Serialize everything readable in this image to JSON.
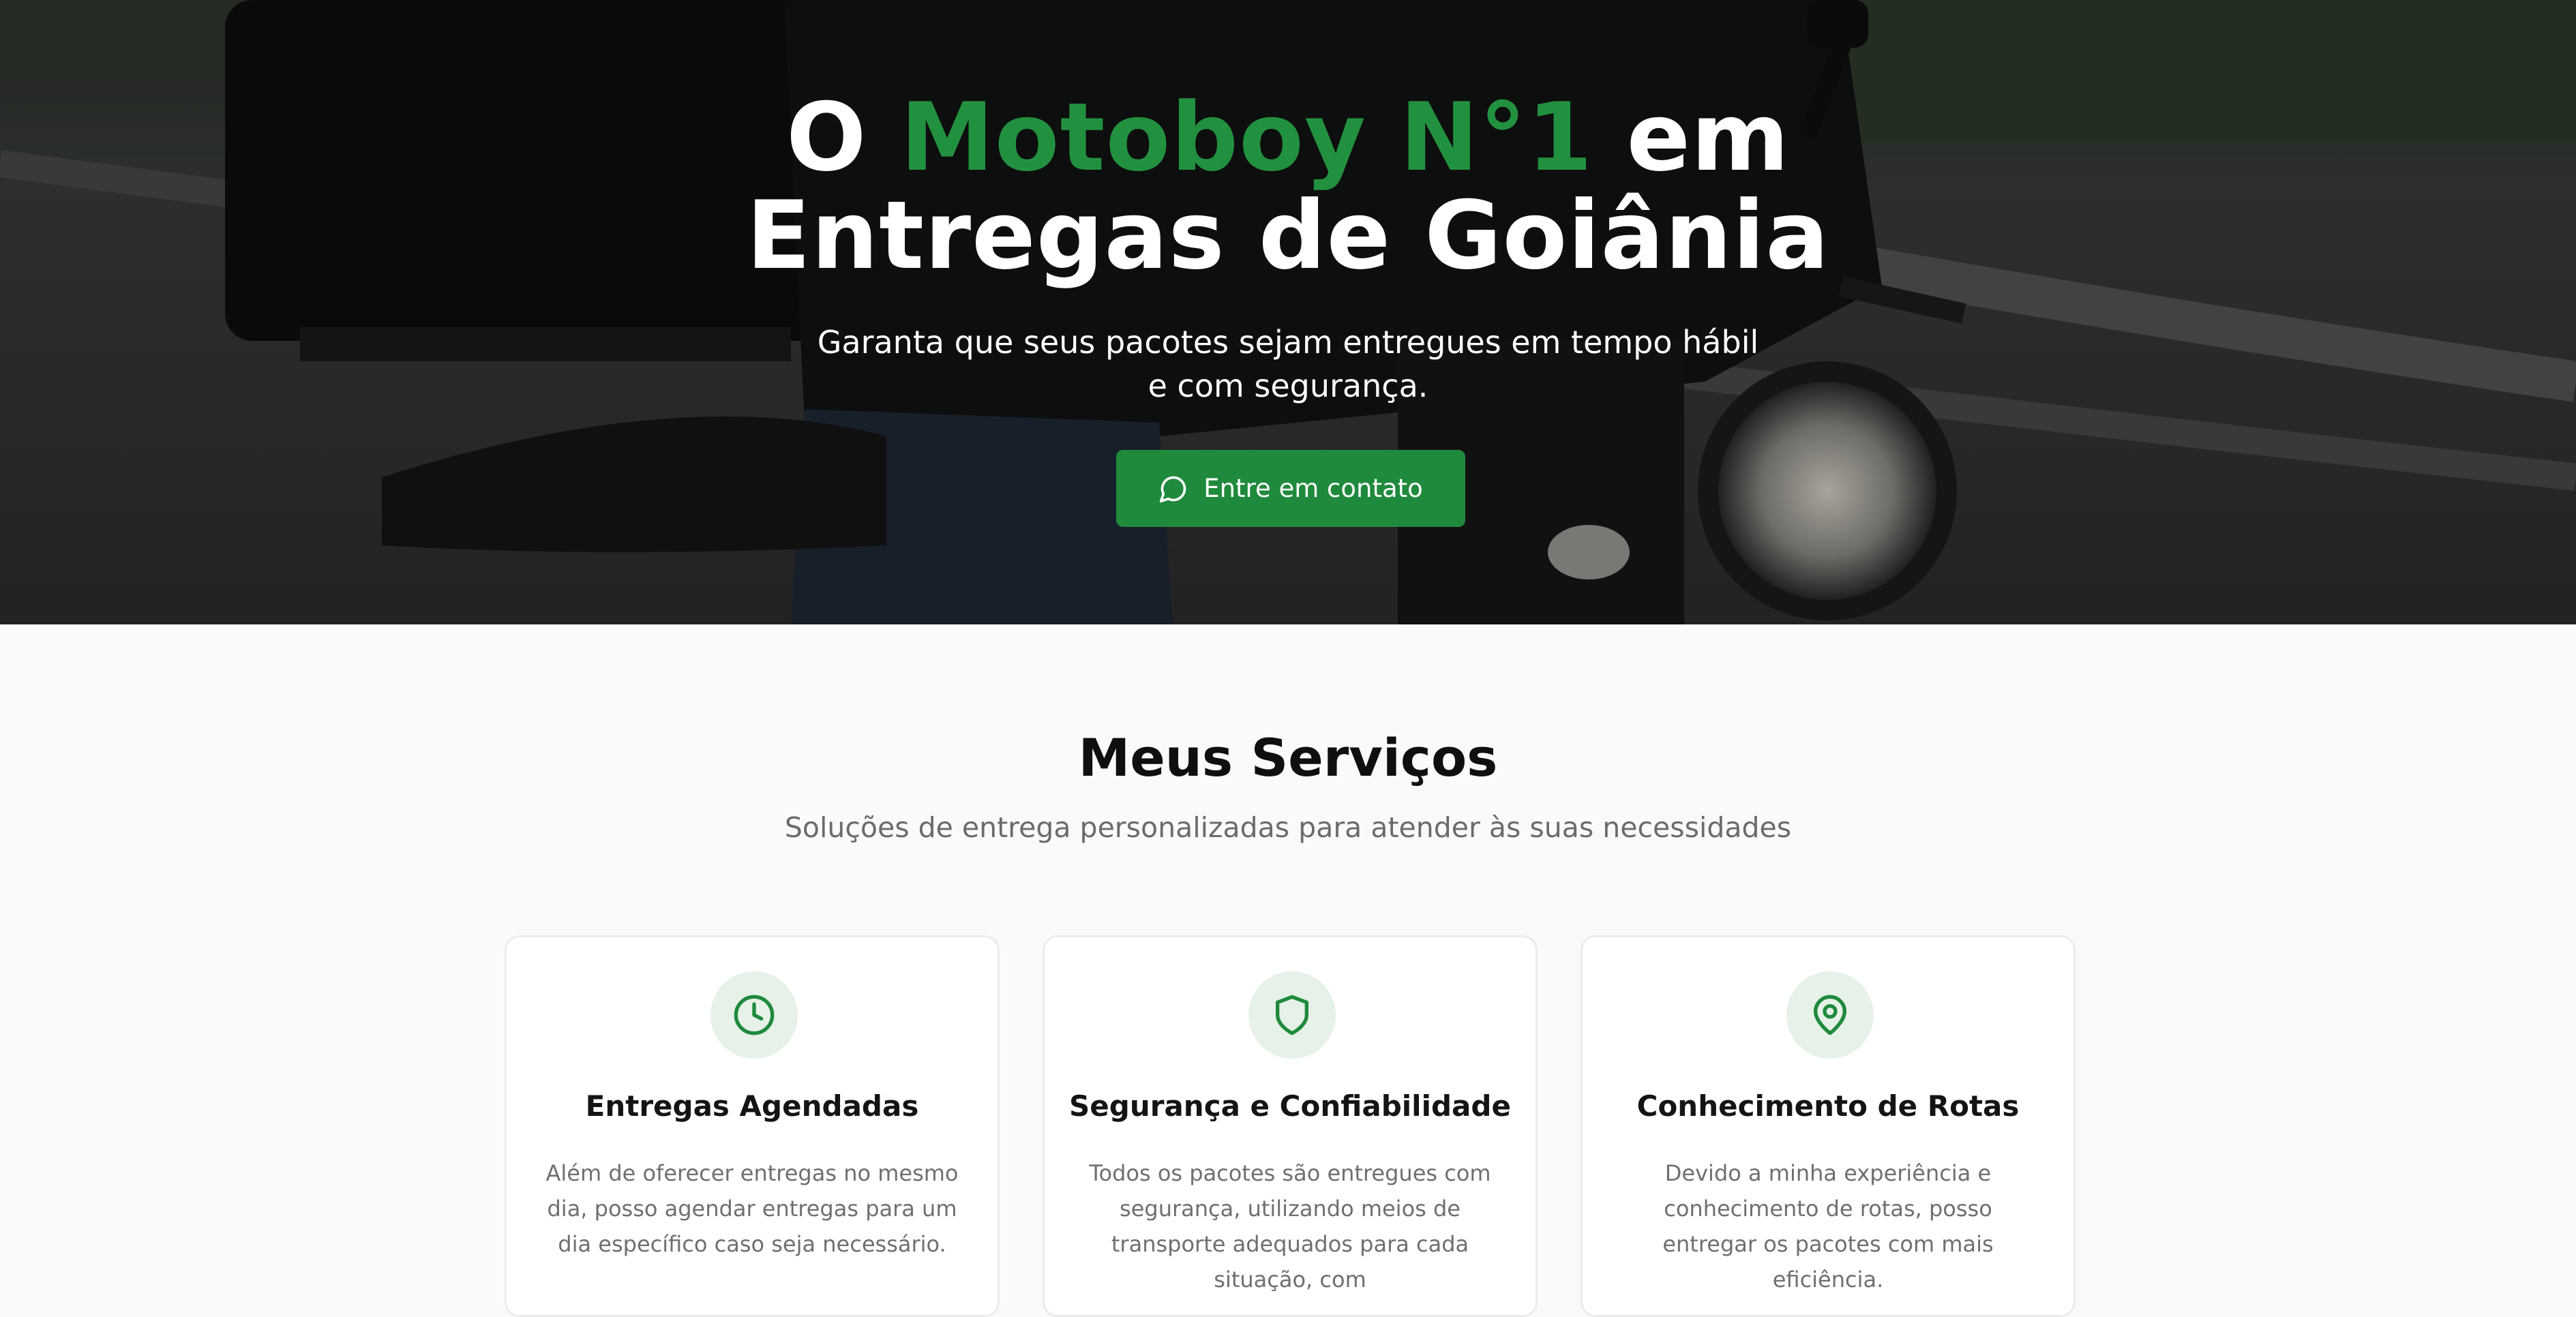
{
  "hero": {
    "title_line1_prefix": "O ",
    "title_line1_accent": "Motoboy N°1",
    "title_line1_suffix": " em",
    "title_line2": "Entregas de Goiânia",
    "subtitle": "Garanta que seus pacotes sejam entregues em tempo hábil e com segurança.",
    "cta_label": "Entre em contato",
    "cta_icon": "message-circle-icon"
  },
  "services": {
    "title": "Meus Serviços",
    "subtitle": "Soluções de entrega personalizadas para atender às suas necessidades",
    "cards": [
      {
        "icon": "clock-icon",
        "title": "Entregas Agendadas",
        "text": "Além de oferecer entregas no mesmo dia, posso agendar entregas para um dia específico caso seja necessário."
      },
      {
        "icon": "shield-icon",
        "title": "Segurança e Confiabilidade",
        "text": "Todos os pacotes são entregues com segurança, utilizando meios de transporte adequados para cada situação, com"
      },
      {
        "icon": "map-pin-icon",
        "title": "Conhecimento de Rotas",
        "text": "Devido a minha experiência e conhecimento de rotas, posso entregar os pacotes com mais eficiência."
      }
    ]
  },
  "colors": {
    "accent": "#22913f",
    "button": "#1f8a3c",
    "icon_bg": "#e6f1e8"
  }
}
